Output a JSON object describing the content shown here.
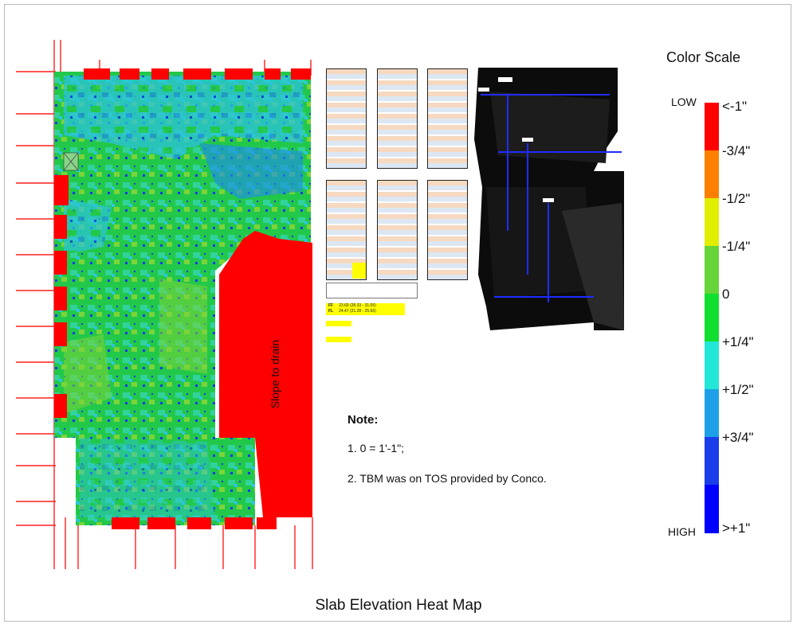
{
  "figure": {
    "title": "Slab Elevation Heat Map"
  },
  "heatmap": {
    "annotation": "Slope to drain"
  },
  "scale": {
    "title": "Color Scale",
    "low_label": "LOW",
    "high_label": "HIGH",
    "bands": [
      {
        "label": "<-1\"",
        "color": "#ff0000"
      },
      {
        "label": "-3/4\"",
        "color": "#ff8000"
      },
      {
        "label": "-1/2\"",
        "color": "#e0ee00"
      },
      {
        "label": "-1/4\"",
        "color": "#66d43a"
      },
      {
        "label": "0",
        "color": "#11df2f"
      },
      {
        "label": "+1/4\"",
        "color": "#22e6d6"
      },
      {
        "label": "+1/2\"",
        "color": "#1ea0e6"
      },
      {
        "label": "+3/4\"",
        "color": "#1a3ee9"
      },
      {
        "label": ">+1\"",
        "color": "#0000ff"
      }
    ]
  },
  "notes": {
    "title": "Note:",
    "items": [
      "1. 0 = 1'-1\";",
      "2. TBM was on TOS provided by Conco."
    ]
  },
  "summary": {
    "ff": "FF",
    "ff_value": "23.69 (28.33 - 31.05)",
    "fl": "FL",
    "fl_value": "24.47 (21.28 - 25.66)"
  }
}
